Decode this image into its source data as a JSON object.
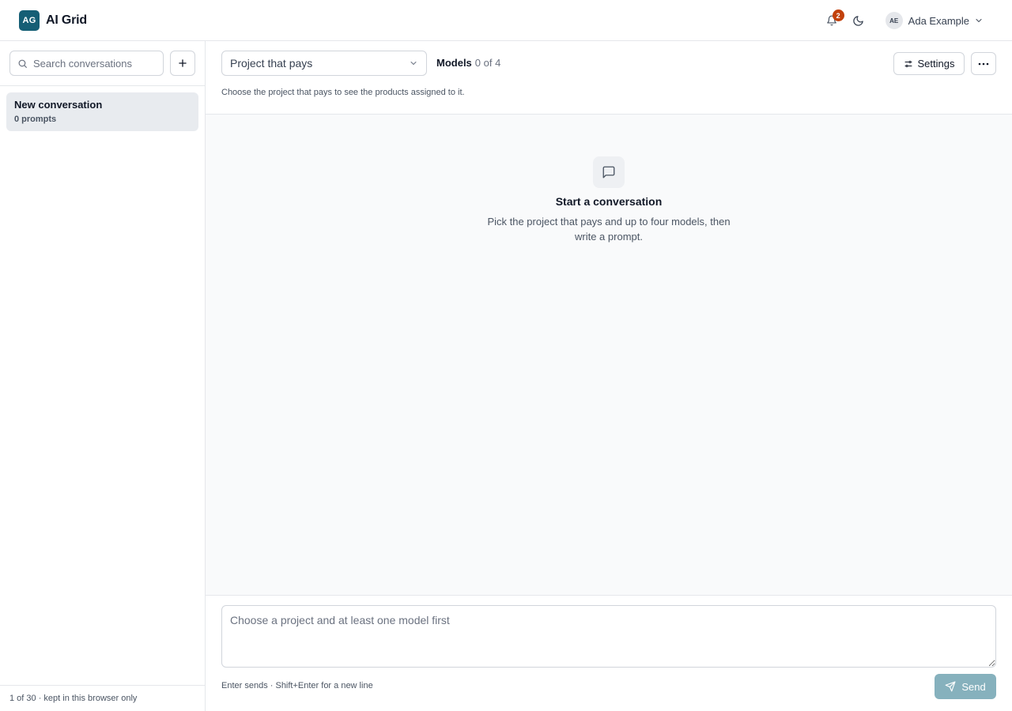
{
  "header": {
    "logo_initials": "AG",
    "app_title": "AI Grid",
    "notifications_count": "2",
    "user": {
      "initials": "AE",
      "name": "Ada Example"
    }
  },
  "sidebar": {
    "search_placeholder": "Search conversations",
    "conversations": [
      {
        "title": "New conversation",
        "subtitle": "0 prompts"
      }
    ],
    "footer": "1 of 30 · kept in this browser only"
  },
  "toolbar": {
    "project_select": "Project that pays",
    "models_label": "Models",
    "models_count": "0 of 4",
    "settings_label": "Settings",
    "hint": "Choose the project that pays to see the products assigned to it."
  },
  "empty_state": {
    "title": "Start a conversation",
    "description": "Pick the project that pays and up to four models, then write a prompt."
  },
  "composer": {
    "placeholder": "Choose a project and at least one model first",
    "keyboard_hint": "Enter sends · Shift+Enter for a new line",
    "send_label": "Send"
  },
  "icons": {
    "search": "search-icon",
    "add": "plus-icon",
    "bell": "bell-icon",
    "theme": "moon-icon",
    "chevron": "chevron-down-icon",
    "settings": "sliders-icon",
    "more": "ellipsis-icon",
    "chat": "message-square-icon",
    "send": "send-icon"
  },
  "colors": {
    "brand": "#155e75",
    "badge": "#c2410c",
    "send_disabled": "#86b1bd"
  }
}
